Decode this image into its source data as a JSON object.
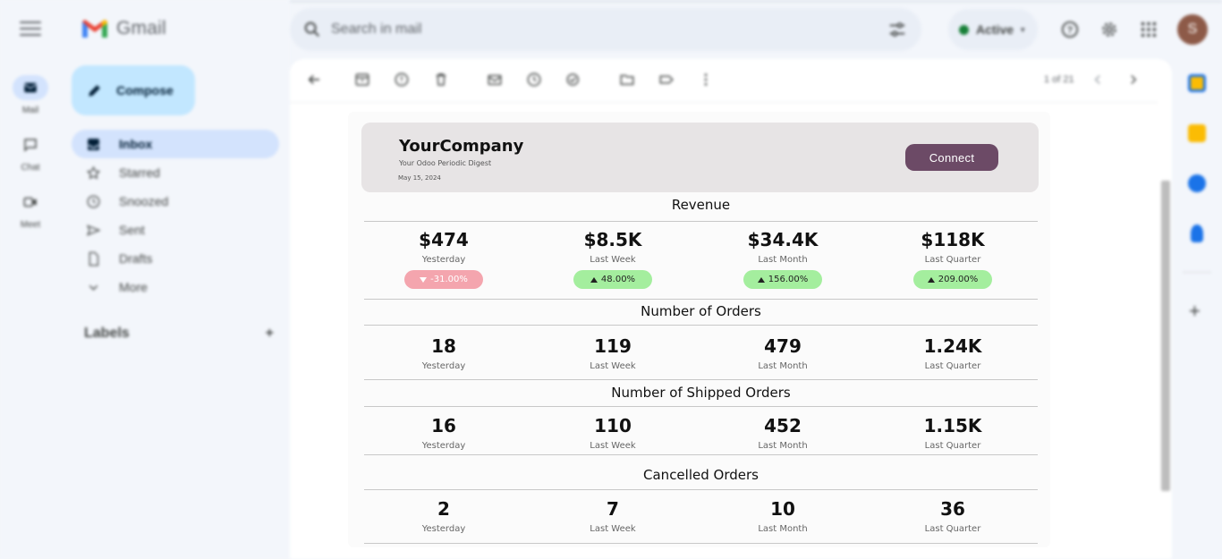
{
  "gmail": {
    "brand": "Gmail",
    "rail": [
      {
        "label": "Mail",
        "icon": "mail-icon",
        "active": true
      },
      {
        "label": "Chat",
        "icon": "chat-icon",
        "active": false
      },
      {
        "label": "Meet",
        "icon": "meet-icon",
        "active": false
      }
    ],
    "compose_label": "Compose",
    "nav": [
      {
        "label": "Inbox",
        "icon": "inbox-icon",
        "active": true
      },
      {
        "label": "Starred",
        "icon": "star-icon",
        "active": false
      },
      {
        "label": "Snoozed",
        "icon": "clock-icon",
        "active": false
      },
      {
        "label": "Sent",
        "icon": "send-icon",
        "active": false
      },
      {
        "label": "Drafts",
        "icon": "draft-icon",
        "active": false
      },
      {
        "label": "More",
        "icon": "chevron-down-icon",
        "active": false
      }
    ],
    "labels_heading": "Labels",
    "labels_add": "+",
    "search_placeholder": "Search in mail",
    "status_label": "Active",
    "avatar_initial": "S",
    "pager": "1 of 21"
  },
  "email": {
    "company": "YourCompany",
    "subtitle": "Your Odoo Periodic Digest",
    "date": "May 15, 2024",
    "connect_label": "Connect",
    "sections": [
      {
        "title": "Revenue",
        "metrics": [
          {
            "value": "$474",
            "label": "Yesterday",
            "change": "-31.00%",
            "trend": "down"
          },
          {
            "value": "$8.5K",
            "label": "Last Week",
            "change": "48.00%",
            "trend": "up"
          },
          {
            "value": "$34.4K",
            "label": "Last Month",
            "change": "156.00%",
            "trend": "up"
          },
          {
            "value": "$118K",
            "label": "Last Quarter",
            "change": "209.00%",
            "trend": "up"
          }
        ]
      },
      {
        "title": "Number of Orders",
        "metrics": [
          {
            "value": "18",
            "label": "Yesterday"
          },
          {
            "value": "119",
            "label": "Last Week"
          },
          {
            "value": "479",
            "label": "Last Month"
          },
          {
            "value": "1.24K",
            "label": "Last Quarter"
          }
        ]
      },
      {
        "title": "Number of Shipped Orders",
        "metrics": [
          {
            "value": "16",
            "label": "Yesterday"
          },
          {
            "value": "110",
            "label": "Last Week"
          },
          {
            "value": "452",
            "label": "Last Month"
          },
          {
            "value": "1.15K",
            "label": "Last Quarter"
          }
        ]
      },
      {
        "title": "Cancelled Orders",
        "metrics": [
          {
            "value": "2",
            "label": "Yesterday"
          },
          {
            "value": "7",
            "label": "Last Week"
          },
          {
            "value": "10",
            "label": "Last Month"
          },
          {
            "value": "36",
            "label": "Last Quarter"
          }
        ]
      }
    ]
  },
  "colors": {
    "connect_button": "#6c4a66",
    "badge_up": "#a4ee9e",
    "badge_down": "#f4a5ae",
    "header_bg": "#e7e4e5",
    "nav_active": "#d3e3fd",
    "compose_bg": "#c2e7ff"
  }
}
